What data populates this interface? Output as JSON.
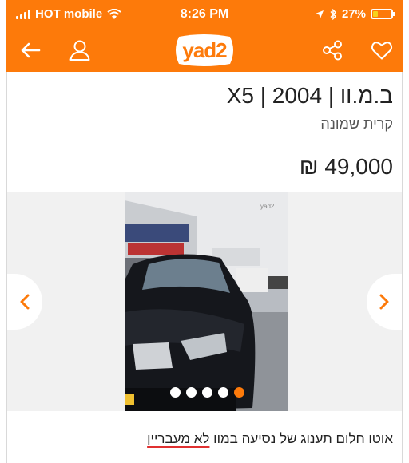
{
  "status_bar": {
    "carrier": "HOT mobile",
    "time": "8:26 PM",
    "battery_percent": "27%",
    "battery_level": 0.27
  },
  "nav": {
    "logo_text": "yad2",
    "back_icon": "back-arrow-icon",
    "profile_icon": "user-icon",
    "share_icon": "share-icon",
    "favorite_icon": "heart-icon"
  },
  "listing": {
    "title": "ב.מ.וו | 2004 | X5",
    "location": "קרית שמונה",
    "price": "49,000 ₪",
    "description_prefix": "אוטו חלום תענוג של נסיעה במוו ",
    "description_underlined": "לא מעבריין"
  },
  "gallery": {
    "image_count": 5,
    "active_index": 4
  },
  "colors": {
    "brand": "#fd7a0a",
    "underline": "#e03030"
  }
}
